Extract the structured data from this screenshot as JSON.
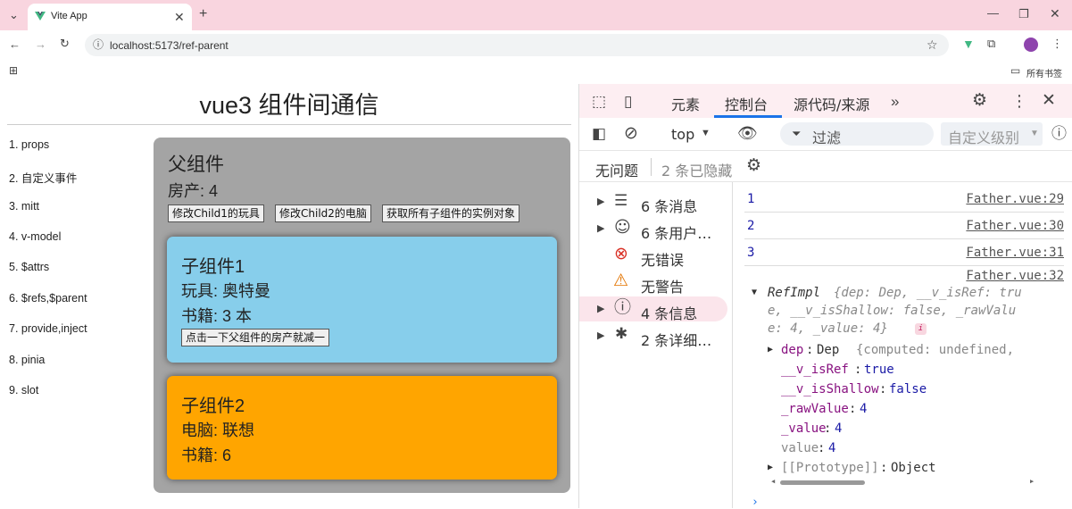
{
  "browser": {
    "tab_title": "Vite App",
    "url": "localhost:5173/ref-parent",
    "bookmarks_label": "所有书签"
  },
  "page": {
    "title": "vue3 组件间通信",
    "nav": [
      "1. props",
      "2. 自定义事件",
      "3. mitt",
      "4. v-model",
      "5. $attrs",
      "6. $refs,$parent",
      "7. provide,inject",
      "8. pinia",
      "9. slot"
    ],
    "parent": {
      "title": "父组件",
      "house": "房产: 4",
      "buttons": [
        "修改Child1的玩具",
        "修改Child2的电脑",
        "获取所有子组件的实例对象"
      ]
    },
    "child1": {
      "title": "子组件1",
      "toy": "玩具: 奥特曼",
      "books": "书籍: 3 本",
      "button": "点击一下父组件的房产就减一"
    },
    "child2": {
      "title": "子组件2",
      "computer": "电脑: 联想",
      "books": "书籍: 6"
    },
    "colors": {
      "parent_bg": "#a4a4a4",
      "child1_bg": "#87ceeb",
      "child2_bg": "#ffa500"
    }
  },
  "devtools": {
    "tabs": [
      "元素",
      "控制台",
      "源代码/来源"
    ],
    "active_tab": "控制台",
    "context": "top",
    "filter_placeholder": "过滤",
    "level_select": "自定义级别",
    "issues": "无问题",
    "hidden_count": "2 条已隐藏",
    "sidebar": [
      "6 条消息",
      "6 条用户…",
      "无错误",
      "无警告",
      "4 条信息",
      "2 条详细…"
    ],
    "logs": [
      {
        "value": "1",
        "source": "Father.vue:29"
      },
      {
        "value": "2",
        "source": "Father.vue:30"
      },
      {
        "value": "3",
        "source": "Father.vue:31"
      },
      {
        "value": "",
        "source": "Father.vue:32"
      }
    ],
    "object": {
      "class_name": "RefImpl",
      "preview_line1": "{dep: Dep, __v_isRef: tru",
      "preview_line2": "e, __v_isShallow: false, _rawValu",
      "preview_line3": "e: 4, _value: 4}",
      "dep_key": "dep",
      "dep_val": "Dep",
      "dep_preview": "{computed: undefined,",
      "isRef_key": "__v_isRef",
      "isRef_val": "true",
      "isShallow_key": "__v_isShallow",
      "isShallow_val": "false",
      "rawValue_key": "_rawValue",
      "rawValue_val": "4",
      "value_key": "_value",
      "value_val": "4",
      "getter_key": "value",
      "getter_val": "4",
      "proto_key": "[[Prototype]]",
      "proto_val": "Object"
    }
  }
}
